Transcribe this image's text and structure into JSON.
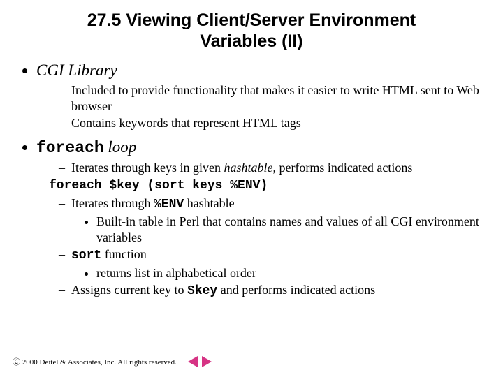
{
  "title": "27.5 Viewing Client/Server Environment Variables (II)",
  "b1": {
    "head": "CGI Library",
    "d1": "Included to provide functionality that makes it easier to write HTML sent to Web browser",
    "d2": "Contains keywords that represent HTML tags"
  },
  "b2": {
    "mono": "foreach",
    "tail": " loop",
    "d1a": "Iterates through keys in given ",
    "d1b": "hashtable",
    "d1c": ", performs indicated actions",
    "code": "foreach $key (sort keys %ENV)",
    "d2a": "Iterates through ",
    "d2b": "%ENV",
    "d2c": " hashtable",
    "s1": "Built-in table in Perl that contains names and values of all CGI environment variables",
    "d3a": "sort",
    "d3b": " function",
    "s2": "returns list in alphabetical order",
    "d4a": "Assigns current key to ",
    "d4b": "$key",
    "d4c": " and performs indicated actions"
  },
  "footer": "Ⓒ 2000 Deitel & Associates, Inc.  All rights reserved."
}
